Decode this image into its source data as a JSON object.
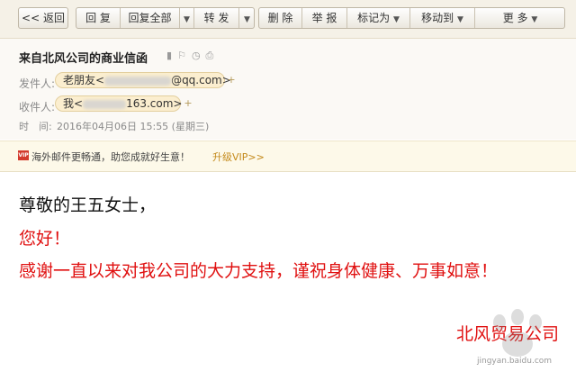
{
  "toolbar": {
    "back": "<< 返回",
    "reply": "回 复",
    "reply_all": "回复全部",
    "forward": "转 发",
    "delete": "删 除",
    "report": "举 报",
    "mark_as": "标记为",
    "move_to": "移动到",
    "more": "更 多"
  },
  "icons": [
    "flag-icon",
    "pin-icon",
    "clock-icon",
    "print-icon",
    "chevron-down-icon",
    "plus-icon",
    "vip-icon"
  ],
  "mail": {
    "subject": "来自北风公司的商业信函",
    "from_label": "发件人:",
    "from_name": "老朋友<",
    "from_domain": "@qq.com>",
    "to_label": "收件人:",
    "to_name": "我<",
    "to_domain": "163.com>",
    "time_label": "时　间:",
    "time_value": "2016年04月06日 15:55 (星期三)"
  },
  "promo": {
    "text": "海外邮件更畅通，助您成就好生意！",
    "link": "升级VIP>>"
  },
  "body": {
    "greeting": "尊敬的王五女士，",
    "hello": "您好！",
    "message": "感谢一直以来对我公司的大力支持，谨祝身体健康、万事如意！",
    "signature": "北风贸易公司"
  },
  "watermark": "jingyan.baidu.com",
  "colors": {
    "accent_red": "#e01010",
    "chip_bg": "#fbeecf",
    "toolbar_bg": "#f5f1e7"
  }
}
